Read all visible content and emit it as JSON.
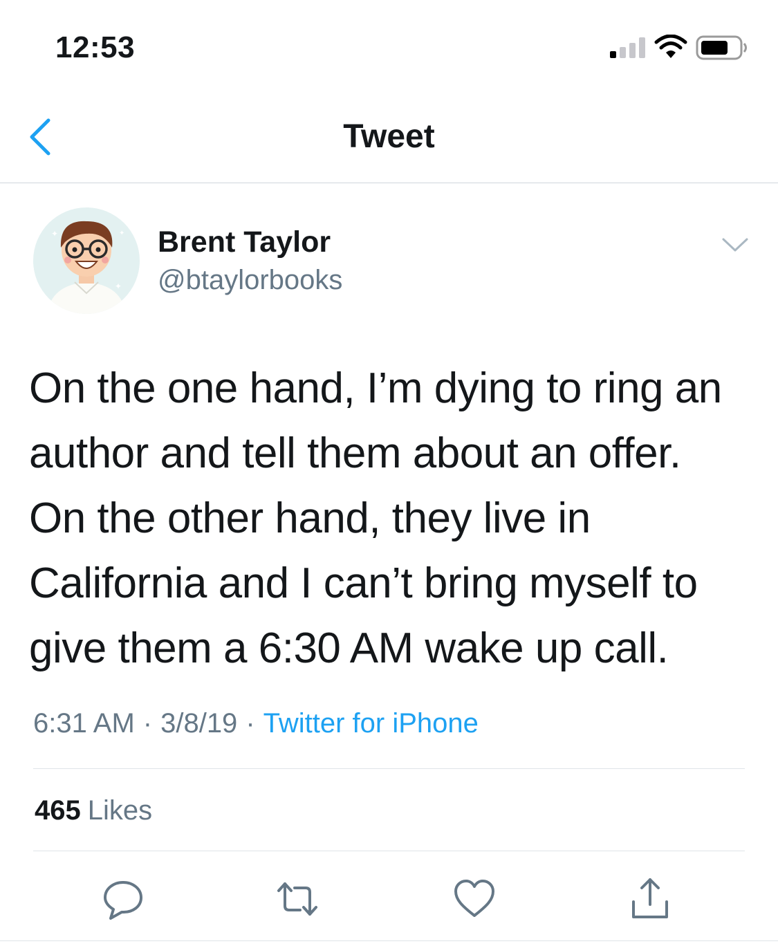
{
  "status_bar": {
    "time": "12:53",
    "icons": [
      "signal-icon",
      "wifi-icon",
      "battery-icon"
    ]
  },
  "nav": {
    "title": "Tweet",
    "back_icon": "chevron-left-icon"
  },
  "author": {
    "name": "Brent Taylor",
    "handle": "@btaylorbooks"
  },
  "tweet": {
    "lines": [
      "On the one hand, I’m dying to ring an",
      "author and tell them about an offer.",
      "On the other hand, they live in",
      "California and I can’t bring myself to",
      "give them a 6:30 AM wake up call."
    ],
    "time": "6:31 AM",
    "separator": "·",
    "date": "3/8/19",
    "source": "Twitter for iPhone"
  },
  "stats": {
    "likes_count": "465",
    "likes_label": "Likes"
  },
  "actions": [
    "reply-icon",
    "retweet-icon",
    "heart-icon",
    "share-icon"
  ],
  "colors": {
    "accent": "#1da1f2",
    "text": "#14171a",
    "secondary": "#657786",
    "icon": "#657786"
  }
}
